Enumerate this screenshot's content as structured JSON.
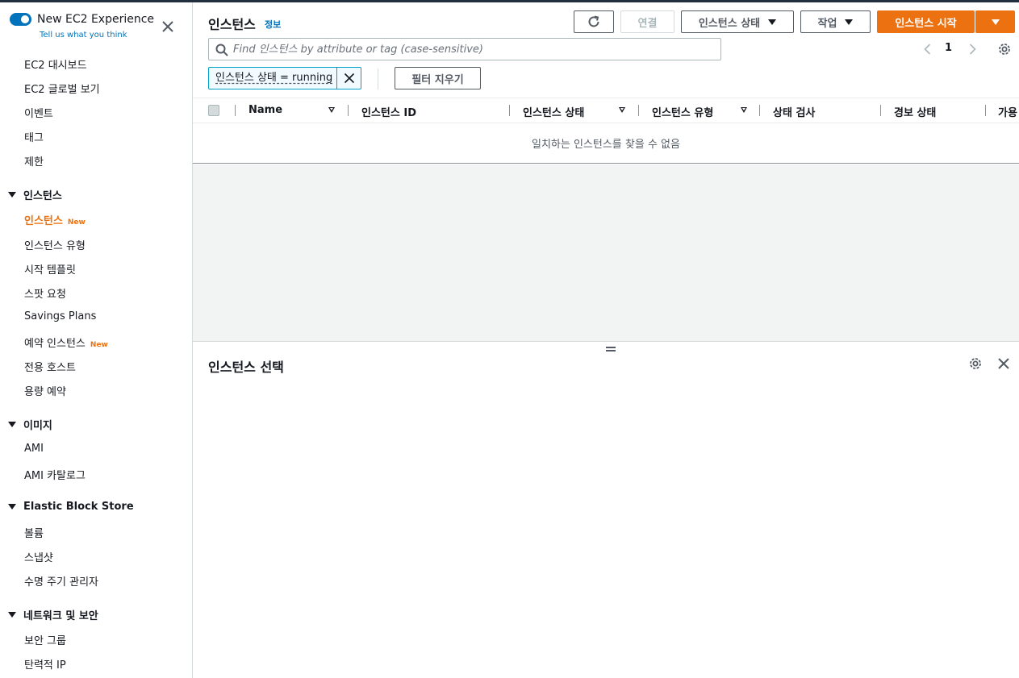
{
  "sidebar": {
    "experience_title": "New EC2 Experience",
    "experience_link": "Tell us what you think",
    "items": [
      {
        "label": "EC2 대시보드"
      },
      {
        "label": "EC2 글로벌 보기"
      },
      {
        "label": "이벤트"
      },
      {
        "label": "태그"
      },
      {
        "label": "제한"
      }
    ],
    "groups": [
      {
        "label": "인스턴스",
        "items": [
          {
            "label": "인스턴스",
            "badge": "New",
            "active": true
          },
          {
            "label": "인스턴스 유형"
          },
          {
            "label": "시작 템플릿"
          },
          {
            "label": "스팟 요청"
          },
          {
            "label": "Savings Plans"
          },
          {
            "label": "예약 인스턴스",
            "badge": "New"
          },
          {
            "label": "전용 호스트"
          },
          {
            "label": "용량 예약"
          }
        ]
      },
      {
        "label": "이미지",
        "items": [
          {
            "label": "AMI"
          },
          {
            "label": "AMI 카탈로그"
          }
        ]
      },
      {
        "label": "Elastic Block Store",
        "items": [
          {
            "label": "볼륨"
          },
          {
            "label": "스냅샷"
          },
          {
            "label": "수명 주기 관리자"
          }
        ]
      },
      {
        "label": "네트워크 및 보안",
        "items": [
          {
            "label": "보안 그룹"
          },
          {
            "label": "탄력적 IP"
          }
        ]
      }
    ]
  },
  "header": {
    "title": "인스턴스",
    "info": "정보",
    "connect": "연결",
    "instance_state": "인스턴스 상태",
    "actions": "작업",
    "launch": "인스턴스 시작"
  },
  "search": {
    "placeholder": "Find 인스턴스 by attribute or tag (case-sensitive)"
  },
  "pagination": {
    "current": "1"
  },
  "filter": {
    "token": "인스턴스 상태 = running",
    "clear": "필터 지우기"
  },
  "table": {
    "columns": [
      "Name",
      "인스턴스 ID",
      "인스턴스 상태",
      "인스턴스 유형",
      "상태 검사",
      "경보 상태",
      "가용"
    ],
    "empty": "일치하는 인스턴스를 찾을 수 없음"
  },
  "split_panel": {
    "title": "인스턴스 선택"
  },
  "colors": {
    "accent": "#ec7211",
    "link": "#0073bb",
    "border": "#d5dbdb"
  }
}
